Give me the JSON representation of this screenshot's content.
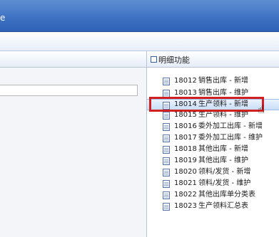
{
  "window": {
    "title_fragment": "e"
  },
  "right_panel": {
    "header_title": "明细功能",
    "items": [
      {
        "code": "18012",
        "label": "销售出库 - 新增"
      },
      {
        "code": "18013",
        "label": "销售出库 - 维护"
      },
      {
        "code": "18014",
        "label": "生产领料 - 新增"
      },
      {
        "code": "18015",
        "label": "生产领料 - 维护"
      },
      {
        "code": "18016",
        "label": "委外加工出库 - 新增"
      },
      {
        "code": "18017",
        "label": "委外加工出库 - 维护"
      },
      {
        "code": "18018",
        "label": "其他出库 - 新增"
      },
      {
        "code": "18019",
        "label": "其他出库 - 维护"
      },
      {
        "code": "18020",
        "label": "领料/发货 - 新增"
      },
      {
        "code": "18021",
        "label": "领料/发货 - 维护"
      },
      {
        "code": "18022",
        "label": "其他出库单分类表"
      },
      {
        "code": "18023",
        "label": "生产领料汇总表"
      }
    ]
  },
  "colors": {
    "titlebar": "#3f72c3",
    "hover_row": "#c9def7",
    "highlight_border": "#d0201f"
  }
}
